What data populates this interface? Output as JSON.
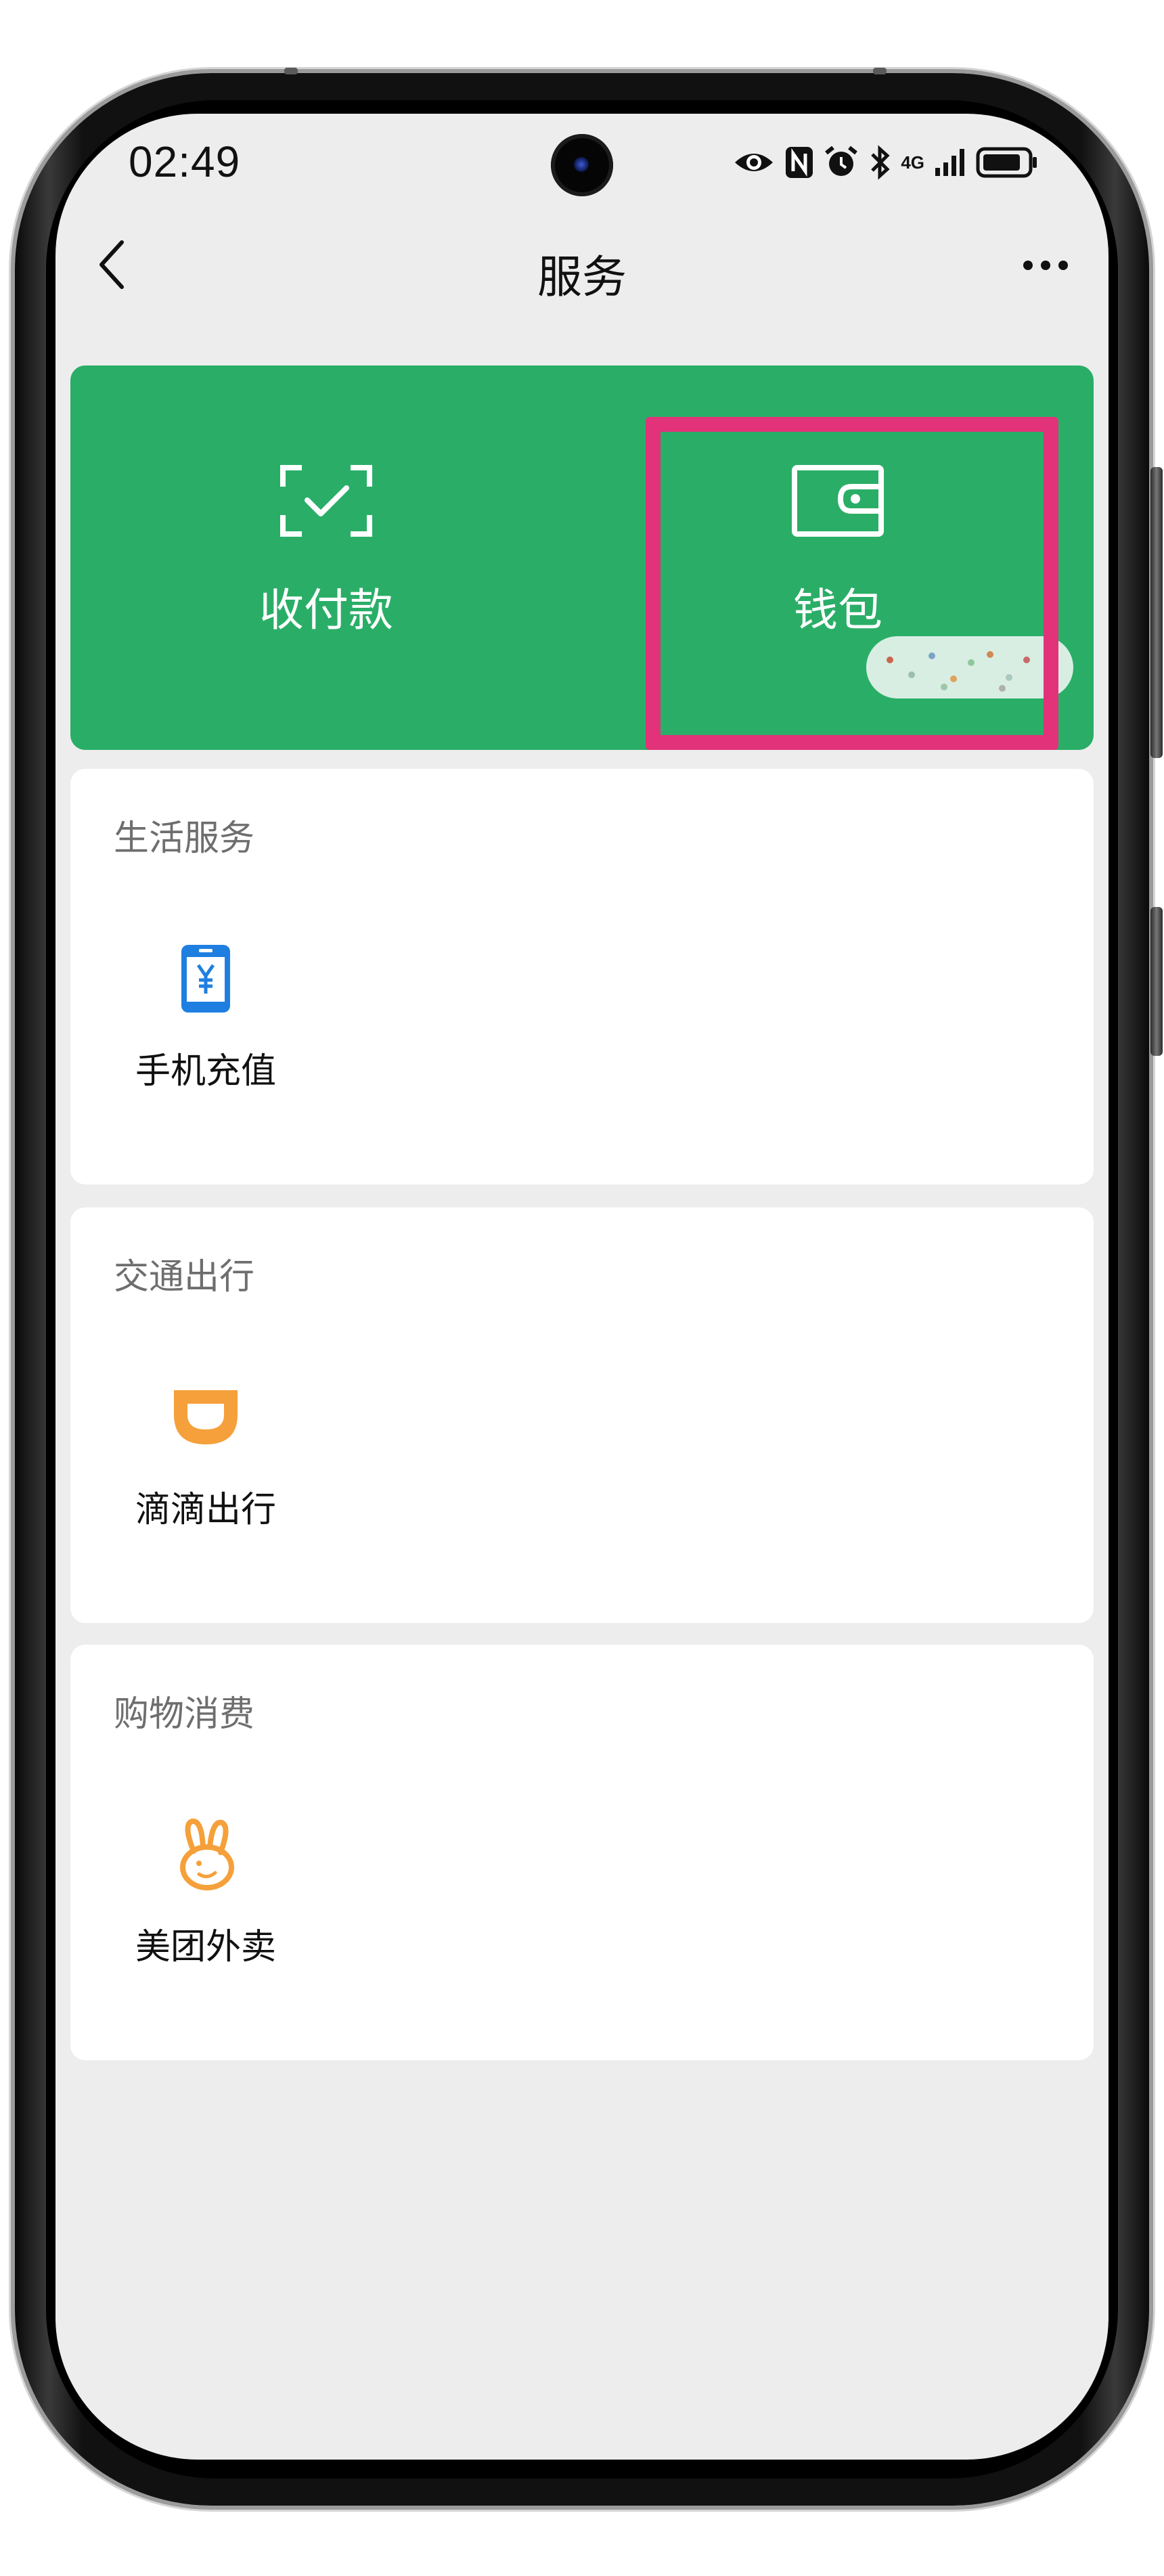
{
  "status_bar": {
    "time": "02:49",
    "network": "4G"
  },
  "nav": {
    "title": "服务"
  },
  "top_panel": {
    "items": [
      {
        "label": "收付款",
        "icon": "scan-check-icon"
      },
      {
        "label": "钱包",
        "icon": "wallet-icon"
      }
    ],
    "colors": {
      "background": "#2aae67",
      "highlight": "#e2327a"
    }
  },
  "sections": [
    {
      "title": "生活服务",
      "items": [
        {
          "label": "手机充值",
          "icon": "phone-recharge-icon",
          "color": "#1f7fe0"
        }
      ]
    },
    {
      "title": "交通出行",
      "items": [
        {
          "label": "滴滴出行",
          "icon": "didi-icon",
          "color": "#f5a03a"
        }
      ]
    },
    {
      "title": "购物消费",
      "items": [
        {
          "label": "美团外卖",
          "icon": "meituan-rabbit-icon",
          "color": "#f5a03a"
        }
      ]
    }
  ]
}
